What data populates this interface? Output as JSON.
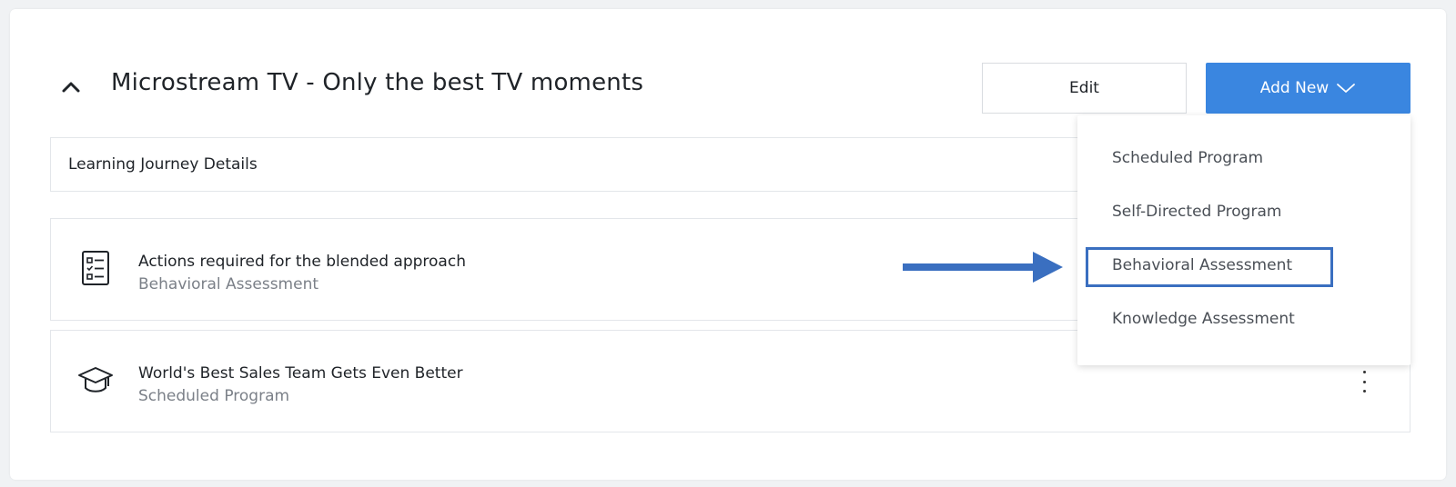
{
  "header": {
    "title": "Microstream TV - Only the best TV moments",
    "edit_label": "Edit",
    "add_new_label": "Add New"
  },
  "section": {
    "label": "Learning Journey Details"
  },
  "rows": [
    {
      "title": "Actions required for the blended approach",
      "subtitle": "Behavioral Assessment",
      "icon": "checklist-icon"
    },
    {
      "title": "World's Best Sales Team Gets Even Better",
      "subtitle": "Scheduled Program",
      "icon": "graduation-cap-icon"
    }
  ],
  "dropdown": {
    "items": [
      {
        "label": "Scheduled Program"
      },
      {
        "label": "Self-Directed Program"
      },
      {
        "label": "Behavioral Assessment",
        "highlighted": true
      },
      {
        "label": "Knowledge Assessment"
      }
    ]
  },
  "colors": {
    "accent": "#3a86e0",
    "annotation": "#3a6fc0",
    "muted_text": "#7b8088"
  }
}
